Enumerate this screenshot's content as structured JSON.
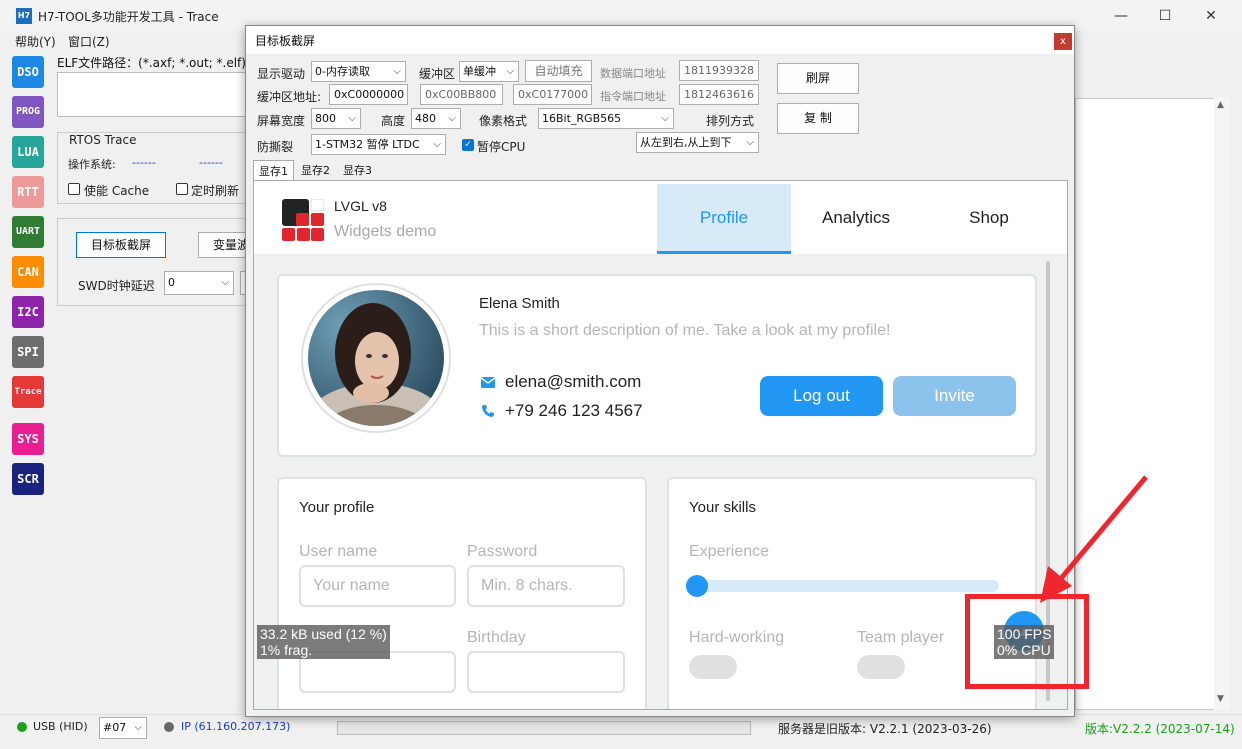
{
  "window": {
    "logo": "H7",
    "title": "H7-TOOL多功能开发工具 - Trace",
    "min": "—",
    "max": "☐",
    "close": "✕"
  },
  "menu": [
    {
      "label": "帮助(Y)"
    },
    {
      "label": "窗口(Z)"
    }
  ],
  "toolbar": [
    {
      "label": "DSO",
      "color": "#1e88e5"
    },
    {
      "label": "PROG",
      "color": "#7e57c2"
    },
    {
      "label": "LUA",
      "color": "#26a69a"
    },
    {
      "label": "RTT",
      "color": "#ef9a9a"
    },
    {
      "label": "UART",
      "color": "#2e7d32"
    },
    {
      "label": "CAN",
      "color": "#fb8c00"
    },
    {
      "label": "I2C",
      "color": "#8e24aa"
    },
    {
      "label": "SPI",
      "color": "#6d6d6d"
    },
    {
      "label": "Trace",
      "color": "#e53935"
    },
    {
      "label": "SYS",
      "color": "#e91e90"
    },
    {
      "label": "SCR",
      "color": "#1a237e"
    }
  ],
  "left": {
    "elf_label": "ELF文件路径：(*.axf; *.out; *.elf)",
    "rtos_title": "RTOS Trace",
    "os_label": "操作系统:",
    "os_value1": "------",
    "os_value2": "------",
    "cache_label": "使能 Cache",
    "refresh_label": "定时刷新",
    "screenshot_button": "目标板截屏",
    "variable_button": "变量波",
    "swd_label": "SWD时钟延迟",
    "swd_value": "0"
  },
  "status": {
    "usb": "USB (HID)",
    "port": "#07",
    "ip": "IP (61.160.207.173)",
    "server_version": "服务器是旧版本: V2.2.1 (2023-03-26)",
    "version": "版本:V2.2.2 (2023-07-14)",
    "usb_color": "#1aa01a",
    "ip_color": "#666666"
  },
  "dialog": {
    "title": "目标板截屏",
    "close": "x",
    "driver_label": "显示驱动",
    "driver_value": "0-内存读取",
    "buffer_label": "缓冲区",
    "buffer_value": "单缓冲",
    "autofill_button": "自动填充",
    "data_port_label": "数据端口地址",
    "data_port_value": "1811939328",
    "buf_addr_label": "缓冲区地址:",
    "buf_addr1": "0xC0000000",
    "buf_addr2": "0xC00BB800",
    "buf_addr3": "0xC0177000",
    "cmd_port_label": "指令端口地址",
    "cmd_port_value": "1812463616",
    "width_label": "屏幕宽度",
    "width_value": "800",
    "height_label": "高度",
    "height_value": "480",
    "pixel_label": "像素格式",
    "pixel_value": "16Bit_RGB565",
    "order_label": "排列方式",
    "order_value": "从左到右,从上到下",
    "tear_label": "防撕裂",
    "tear_value": "1-STM32 暂停 LTDC",
    "pause_cpu_label": "暂停CPU",
    "refresh_button": "刷屏",
    "copy_button": "复 制",
    "tabs": [
      {
        "label": "显存1"
      },
      {
        "label": "显存2"
      },
      {
        "label": "显存3"
      }
    ]
  },
  "lvgl": {
    "title": "LVGL v8",
    "subtitle": "Widgets demo",
    "tabs": [
      {
        "label": "Profile"
      },
      {
        "label": "Analytics"
      },
      {
        "label": "Shop"
      }
    ],
    "name": "Elena Smith",
    "description": "This is a short description of me. Take a look at my profile!",
    "email": "elena@smith.com",
    "phone": "+79 246 123 4567",
    "logout_button": "Log out",
    "invite_button": "Invite",
    "profile_card_title": "Your profile",
    "username_label": "User name",
    "username_placeholder": "Your name",
    "password_label": "Password",
    "password_placeholder": "Min. 8 chars.",
    "birthday_label": "Birthday",
    "skills_card_title": "Your skills",
    "experience_label": "Experience",
    "hardworking_label": "Hard-working",
    "teamplayer_label": "Team player",
    "mem_overlay_1": "33.2 kB used (12 %)",
    "mem_overlay_2": "1% frag.",
    "fps_overlay_1": "100 FPS",
    "fps_overlay_2": "0% CPU",
    "experience_level": 0.0,
    "accent_color": "#2196f3"
  }
}
